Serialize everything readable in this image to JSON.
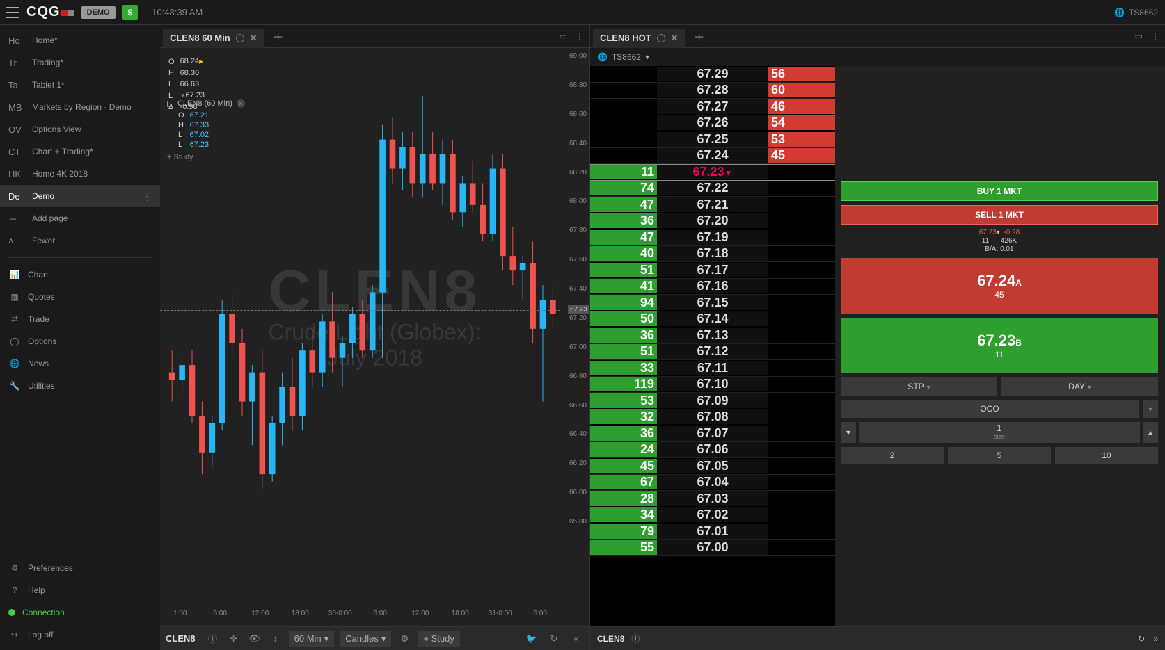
{
  "header": {
    "logo": "CQG",
    "demo": "DEMO",
    "time": "10:48:39 AM",
    "account": "TS8662"
  },
  "nav": {
    "pages": [
      {
        "abbr": "Ho",
        "label": "Home*"
      },
      {
        "abbr": "Tr",
        "label": "Trading*"
      },
      {
        "abbr": "Ta",
        "label": "Tablet 1*"
      },
      {
        "abbr": "MB",
        "label": "Markets by Region - Demo"
      },
      {
        "abbr": "OV",
        "label": "Options View"
      },
      {
        "abbr": "CT",
        "label": "Chart + Trading*"
      },
      {
        "abbr": "HK",
        "label": "Home 4K 2018"
      },
      {
        "abbr": "De",
        "label": "Demo"
      }
    ],
    "add": "Add page",
    "fewer": "Fewer",
    "tools": [
      {
        "icon": "📊",
        "label": "Chart"
      },
      {
        "icon": "▦",
        "label": "Quotes"
      },
      {
        "icon": "⇄",
        "label": "Trade"
      },
      {
        "icon": "◯",
        "label": "Options"
      },
      {
        "icon": "🌐",
        "label": "News"
      },
      {
        "icon": "🔧",
        "label": "Utilities"
      }
    ],
    "bottom": [
      {
        "icon": "⚙",
        "label": "Preferences"
      },
      {
        "icon": "?",
        "label": "Help"
      },
      {
        "icon": "●",
        "label": "Connection",
        "conn": true
      },
      {
        "icon": "↪",
        "label": "Log off"
      }
    ]
  },
  "chart_tab": {
    "title": "CLEN8 60 Min"
  },
  "dom_tab": {
    "title": "CLEN8 HOT",
    "account": "TS8662"
  },
  "watermark": {
    "symbol": "CLEN8",
    "desc": "Crude Light (Globex): July 2018"
  },
  "ohlc": {
    "o": "68.24",
    "h": "68.30",
    "l": "66.63",
    "last": "67.23",
    "delta": "-0.98"
  },
  "study": {
    "name": "CLEN8 (60 Min)",
    "o": "67.21",
    "h": "67.33",
    "l": "67.02",
    "last": "67.23",
    "add": "+ Study"
  },
  "chart_toolbar": {
    "symbol": "CLEN8",
    "interval": "60 Min",
    "type": "Candles",
    "study": "+ Study"
  },
  "price_axis": {
    "min": 65.8,
    "max": 69.0,
    "step": 0.2,
    "current": "67.23"
  },
  "time_axis": [
    "1:00",
    "6:00",
    "12:00",
    "18:00",
    "30-0:00",
    "6:00",
    "12:00",
    "18:00",
    "31-0:00",
    "6:00"
  ],
  "chart_data": {
    "type": "candlestick",
    "title": "CLEN8 60 Min",
    "xlabel": "",
    "ylabel": "",
    "ylim": [
      65.8,
      69.0
    ],
    "candles": [
      {
        "t": 0,
        "o": 66.8,
        "h": 66.95,
        "l": 66.6,
        "c": 66.75
      },
      {
        "t": 1,
        "o": 66.75,
        "h": 66.9,
        "l": 66.65,
        "c": 66.85
      },
      {
        "t": 2,
        "o": 66.85,
        "h": 66.95,
        "l": 66.45,
        "c": 66.5
      },
      {
        "t": 3,
        "o": 66.5,
        "h": 66.6,
        "l": 66.1,
        "c": 66.25
      },
      {
        "t": 4,
        "o": 66.25,
        "h": 66.5,
        "l": 66.15,
        "c": 66.45
      },
      {
        "t": 5,
        "o": 66.45,
        "h": 67.3,
        "l": 66.4,
        "c": 67.2
      },
      {
        "t": 6,
        "o": 67.2,
        "h": 67.35,
        "l": 66.9,
        "c": 67.0
      },
      {
        "t": 7,
        "o": 67.0,
        "h": 67.1,
        "l": 66.5,
        "c": 66.6
      },
      {
        "t": 8,
        "o": 66.6,
        "h": 66.85,
        "l": 66.3,
        "c": 66.8
      },
      {
        "t": 9,
        "o": 66.8,
        "h": 66.95,
        "l": 66.0,
        "c": 66.1
      },
      {
        "t": 10,
        "o": 66.1,
        "h": 66.5,
        "l": 66.05,
        "c": 66.45
      },
      {
        "t": 11,
        "o": 66.45,
        "h": 66.8,
        "l": 66.3,
        "c": 66.7
      },
      {
        "t": 12,
        "o": 66.7,
        "h": 66.9,
        "l": 66.4,
        "c": 66.5
      },
      {
        "t": 13,
        "o": 66.5,
        "h": 67.0,
        "l": 66.4,
        "c": 66.95
      },
      {
        "t": 14,
        "o": 66.95,
        "h": 67.1,
        "l": 66.7,
        "c": 66.8
      },
      {
        "t": 15,
        "o": 66.8,
        "h": 67.2,
        "l": 66.7,
        "c": 67.15
      },
      {
        "t": 16,
        "o": 67.15,
        "h": 67.35,
        "l": 66.8,
        "c": 66.9
      },
      {
        "t": 17,
        "o": 66.9,
        "h": 67.05,
        "l": 66.7,
        "c": 67.0
      },
      {
        "t": 18,
        "o": 67.0,
        "h": 67.25,
        "l": 66.9,
        "c": 67.2
      },
      {
        "t": 19,
        "o": 67.2,
        "h": 67.3,
        "l": 66.9,
        "c": 66.95
      },
      {
        "t": 20,
        "o": 66.95,
        "h": 67.4,
        "l": 66.9,
        "c": 67.35
      },
      {
        "t": 21,
        "o": 67.35,
        "h": 68.5,
        "l": 66.9,
        "c": 68.4
      },
      {
        "t": 22,
        "o": 68.4,
        "h": 68.55,
        "l": 68.1,
        "c": 68.2
      },
      {
        "t": 23,
        "o": 68.2,
        "h": 68.45,
        "l": 68.05,
        "c": 68.35
      },
      {
        "t": 24,
        "o": 68.35,
        "h": 68.45,
        "l": 68.0,
        "c": 68.1
      },
      {
        "t": 25,
        "o": 68.1,
        "h": 68.7,
        "l": 68.0,
        "c": 68.3
      },
      {
        "t": 26,
        "o": 68.3,
        "h": 68.45,
        "l": 68.05,
        "c": 68.1
      },
      {
        "t": 27,
        "o": 68.1,
        "h": 68.4,
        "l": 67.95,
        "c": 68.3
      },
      {
        "t": 28,
        "o": 68.3,
        "h": 68.4,
        "l": 67.85,
        "c": 67.9
      },
      {
        "t": 29,
        "o": 67.9,
        "h": 68.15,
        "l": 67.8,
        "c": 68.1
      },
      {
        "t": 30,
        "o": 68.1,
        "h": 68.25,
        "l": 67.9,
        "c": 67.95
      },
      {
        "t": 31,
        "o": 67.95,
        "h": 68.1,
        "l": 67.7,
        "c": 67.75
      },
      {
        "t": 32,
        "o": 67.75,
        "h": 68.3,
        "l": 67.7,
        "c": 68.2
      },
      {
        "t": 33,
        "o": 68.2,
        "h": 68.3,
        "l": 67.5,
        "c": 67.6
      },
      {
        "t": 34,
        "o": 67.6,
        "h": 67.8,
        "l": 67.4,
        "c": 67.5
      },
      {
        "t": 35,
        "o": 67.5,
        "h": 67.6,
        "l": 67.3,
        "c": 67.55
      },
      {
        "t": 36,
        "o": 67.55,
        "h": 67.7,
        "l": 67.0,
        "c": 67.1
      },
      {
        "t": 37,
        "o": 67.1,
        "h": 67.4,
        "l": 66.6,
        "c": 67.3
      },
      {
        "t": 38,
        "o": 67.3,
        "h": 67.4,
        "l": 67.1,
        "c": 67.2
      },
      {
        "t": 39,
        "o": 67.21,
        "h": 67.33,
        "l": 67.02,
        "c": 67.23
      }
    ]
  },
  "ladder": {
    "ask_upper": [
      {
        "p": "67.29",
        "q": "56"
      },
      {
        "p": "67.28",
        "q": "60"
      },
      {
        "p": "67.27",
        "q": "46"
      },
      {
        "p": "67.26",
        "q": "54"
      },
      {
        "p": "67.25",
        "q": "53"
      },
      {
        "p": "67.24",
        "q": "45"
      }
    ],
    "trade": {
      "p": "67.23",
      "bid": "11",
      "arrow": "▼"
    },
    "bids": [
      {
        "p": "67.22",
        "q": "74"
      },
      {
        "p": "67.21",
        "q": "47"
      },
      {
        "p": "67.20",
        "q": "36"
      },
      {
        "p": "67.19",
        "q": "47"
      },
      {
        "p": "67.18",
        "q": "40"
      },
      {
        "p": "67.17",
        "q": "51"
      },
      {
        "p": "67.16",
        "q": "41"
      },
      {
        "p": "67.15",
        "q": "94"
      },
      {
        "p": "67.14",
        "q": "50"
      },
      {
        "p": "67.13",
        "q": "36"
      },
      {
        "p": "67.12",
        "q": "51"
      },
      {
        "p": "67.11",
        "q": "33"
      },
      {
        "p": "67.10",
        "q": "119"
      },
      {
        "p": "67.09",
        "q": "53"
      },
      {
        "p": "67.08",
        "q": "32"
      },
      {
        "p": "67.07",
        "q": "36"
      },
      {
        "p": "67.06",
        "q": "24"
      },
      {
        "p": "67.05",
        "q": "45"
      },
      {
        "p": "67.04",
        "q": "67"
      },
      {
        "p": "67.03",
        "q": "28"
      },
      {
        "p": "67.02",
        "q": "34"
      },
      {
        "p": "67.01",
        "q": "79"
      },
      {
        "p": "67.00",
        "q": "55"
      }
    ]
  },
  "trade_panel": {
    "buy": "BUY 1 MKT",
    "sell": "SELL 1 MKT",
    "last": "67.23",
    "chg": "-0.98",
    "bidq": "11",
    "vol": "426K",
    "ba": "B/A: 0.01",
    "ask_p": "67.24",
    "ask_sub": "A",
    "ask_q": "45",
    "bid_p": "67.23",
    "bid_sub": "B",
    "bid_q": "11",
    "stp": "STP",
    "day": "DAY",
    "oco": "OCO",
    "size": "1",
    "size_lbl": "size",
    "q2": "2",
    "q5": "5",
    "q10": "10"
  },
  "dom_toolbar": {
    "symbol": "CLEN8"
  }
}
